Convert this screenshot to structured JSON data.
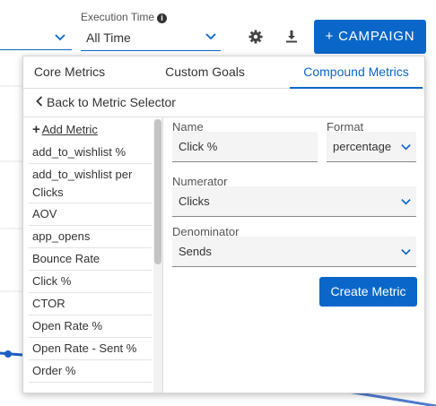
{
  "header": {
    "execution_time_label": "Execution Time",
    "execution_time_value": "All Time",
    "campaign_button_label": "+ CAMPAIGN"
  },
  "tabs": [
    {
      "label": "Core Metrics",
      "active": false
    },
    {
      "label": "Custom Goals",
      "active": false
    },
    {
      "label": "Compound Metrics",
      "active": true
    }
  ],
  "back_label": "Back to Metric Selector",
  "add_metric_label": "Add Metric",
  "metrics": [
    "add_to_wishlist %",
    "add_to_wishlist per Clicks",
    "AOV",
    "app_opens",
    "Bounce Rate",
    "Click %",
    "CTOR",
    "Open Rate %",
    "Open Rate - Sent %",
    "Order %"
  ],
  "form": {
    "name_label": "Name",
    "name_value": "Click %",
    "format_label": "Format",
    "format_value": "percentage",
    "numerator_label": "Numerator",
    "numerator_value": "Clicks",
    "denominator_label": "Denominator",
    "denominator_value": "Sends",
    "create_button_label": "Create Metric"
  },
  "colors": {
    "accent": "#0a67c9"
  }
}
